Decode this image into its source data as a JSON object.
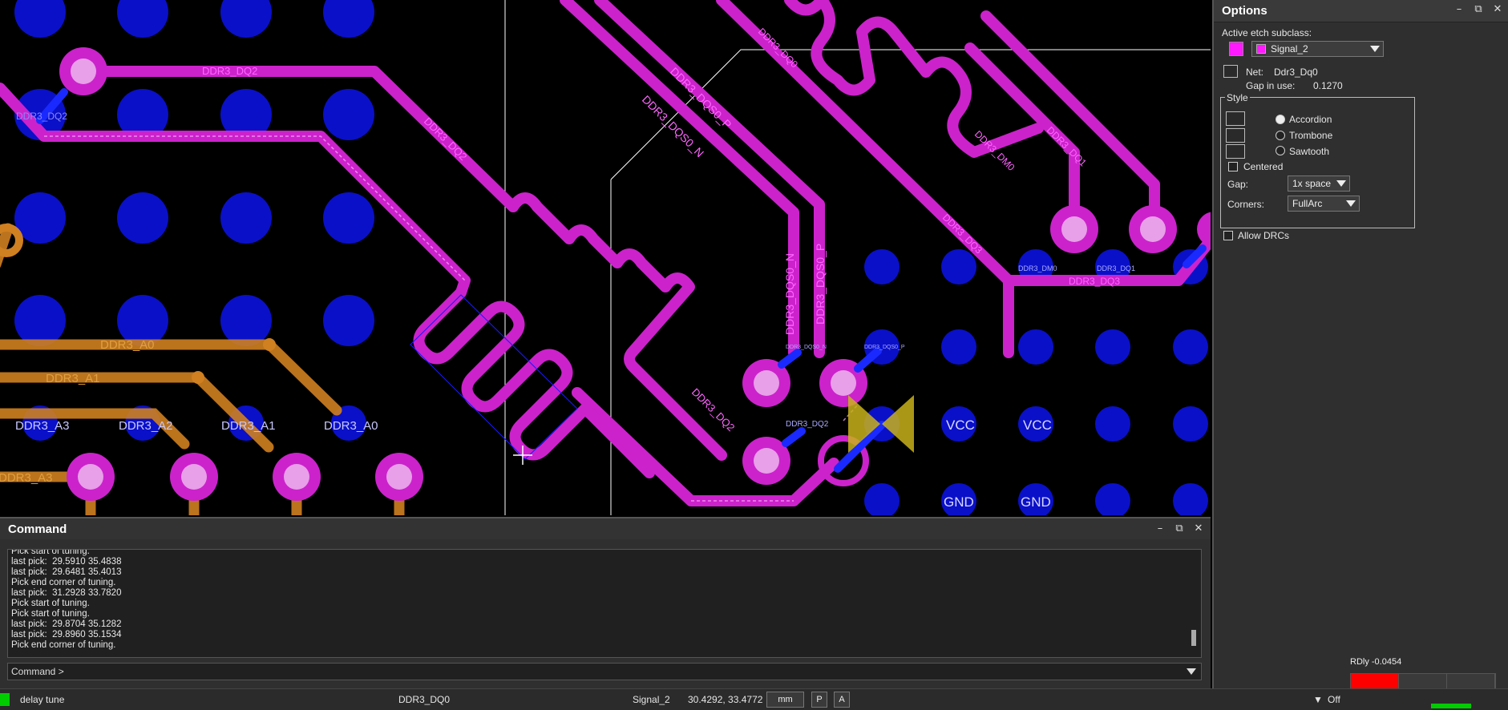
{
  "canvas": {
    "labels": {
      "ddr3_dq2_top": "DDR3_DQ2",
      "ddr3_dq2_left": "DDR3_DQ2",
      "ddr3_dq2_diag": "DDR3_DQ2",
      "ddr3_dqs0_p": "DDR3_DQS0_P",
      "ddr3_dqs0_n": "DDR3_DQS0_N",
      "ddr3_dq0": "DDR3_DQ0",
      "ddr3_dm0": "DDR3_DM0",
      "ddr3_dq1": "DDR3_DQ1",
      "ddr3_dq3": "DDR3_DQ3",
      "ddr3_dm0_small": "DDR3_DM0",
      "ddr3_dq1_small": "DDR3_DQ1",
      "ddr3_dq3_small": "DDR3_DQ3",
      "ddr3_dqs0_n_v": "DDR3_DQS0_N",
      "ddr3_dqs0_p_v": "DDR3_DQS0_P",
      "ddr3_dqs0_n_small": "DDR3_DQS0_N",
      "ddr3_dqs0_p_small": "DDR3_DQS0_P",
      "ddr3_dq2_small": "DDR3_DQ2",
      "ddr3_dq2_lower": "DDR3_DQ2",
      "ddr3_a0_trace": "DDR3_A0",
      "ddr3_a1_trace": "DDR3_A1",
      "ddr3_a3_trace": "DDR3_A3",
      "ddr3_a3": "DDR3_A3",
      "ddr3_a2": "DDR3_A2",
      "ddr3_a1": "DDR3_A1",
      "ddr3_a0": "DDR3_A0",
      "vcc1": "VCC",
      "vcc2": "VCC",
      "gnd1": "GND",
      "gnd2": "GND"
    },
    "colors": {
      "background": "#000000",
      "pad_blue": "#0a10c8",
      "signal_magenta": "#cc22cc",
      "signal_orange": "#d08020",
      "pin_pink": "#e070e0",
      "marker_yellow": "#c9b21a"
    }
  },
  "options": {
    "title": "Options",
    "active_etch_label": "Active etch subclass:",
    "subclass_value": "Signal_2",
    "net_label": "Net:",
    "net_value": "Ddr3_Dq0",
    "gap_in_use_label": "Gap in use:",
    "gap_in_use_value": "0.1270",
    "style_group": "Style",
    "style_accordion": "Accordion",
    "style_trombone": "Trombone",
    "style_sawtooth": "Sawtooth",
    "centered_label": "Centered",
    "gap_label": "Gap:",
    "gap_value": "1x space",
    "corners_label": "Corners:",
    "corners_value": "FullArc",
    "allow_drcs_label": "Allow DRCs"
  },
  "command": {
    "title": "Command",
    "log": [
      "Pick start of tuning.",
      "last pick:  29.5910 35.4838",
      "last pick:  29.6481 35.4013",
      "Pick end corner of tuning.",
      "last pick:  31.2928 33.7820",
      "Pick start of tuning.",
      "Pick start of tuning.",
      "last pick:  29.8704 35.1282",
      "last pick:  29.8960 35.1534",
      "Pick end corner of tuning."
    ],
    "prompt": "Command >"
  },
  "statusbar": {
    "mode": "delay tune",
    "net": "DDR3_DQ0",
    "subclass": "Signal_2",
    "coords": "30.4292, 33.4772",
    "units": "mm",
    "p_button": "P",
    "a_button": "A",
    "filter": "Off",
    "indicator_color": "#00cc00"
  },
  "rdly": {
    "label": "RDly -0.0454",
    "color": "#ff0000"
  }
}
